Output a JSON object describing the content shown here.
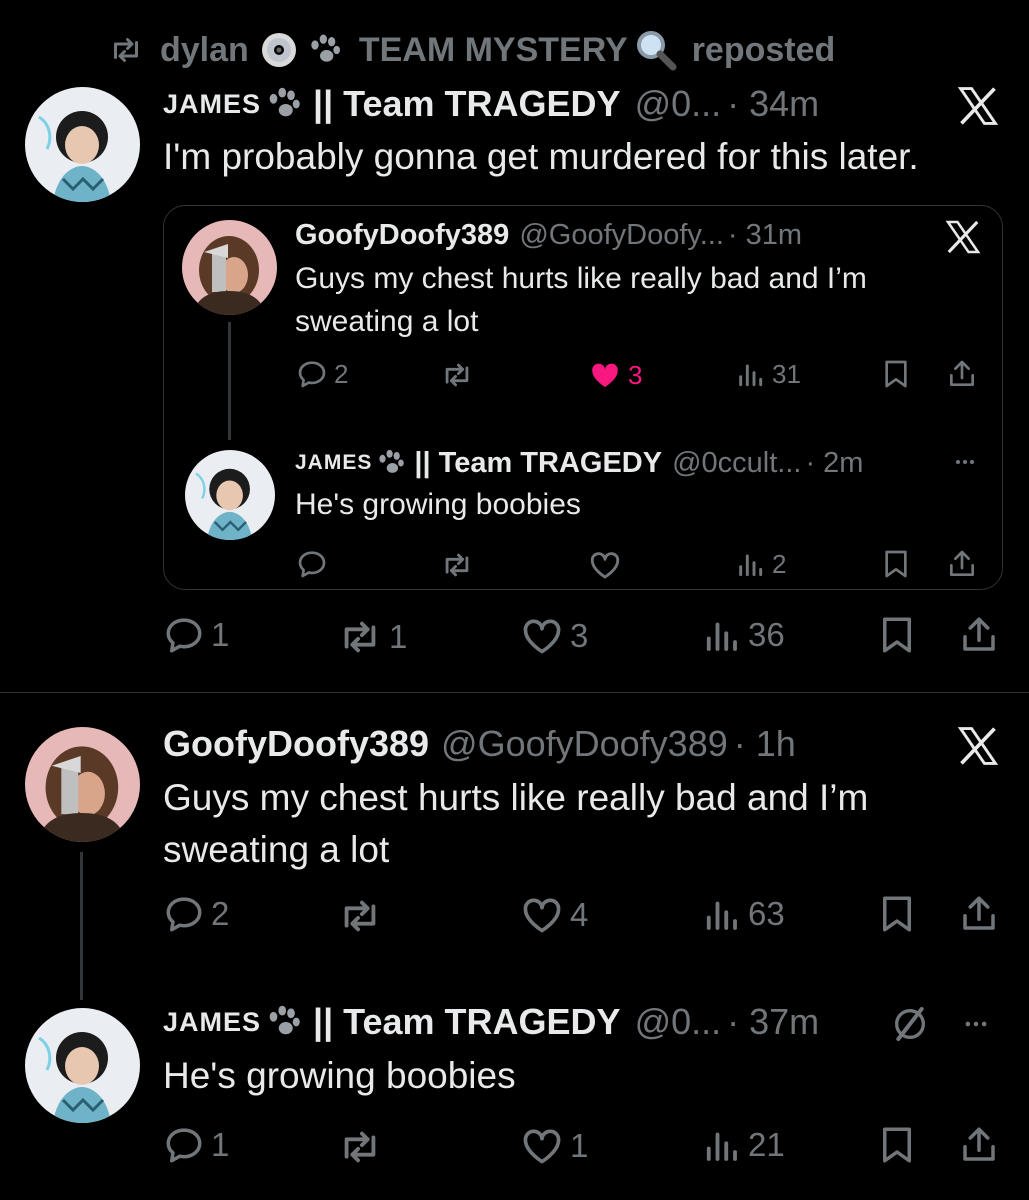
{
  "repost_bar": {
    "reposter_name": "dylan",
    "reposter_extra": "TEAM MYSTERY",
    "label": "reposted"
  },
  "tweet1": {
    "author": "JAMES",
    "team": "|| Team TRAGEDY",
    "handle": "@0...",
    "time": "· 34m",
    "text": "I'm probably gonna get murdered for this later.",
    "stats": {
      "replies": "1",
      "reposts": "1",
      "likes": "3",
      "views": "36"
    }
  },
  "quote": {
    "post1": {
      "author": "GoofyDoofy389",
      "handle": "@GoofyDoofy...",
      "time": "· 31m",
      "text_line1": "Guys my chest hurts like really bad and I’m",
      "text_line2": "sweating a lot",
      "stats": {
        "replies": "2",
        "likes": "3",
        "views": "31"
      }
    },
    "post2": {
      "author": "JAMES",
      "team": "|| Team TRAGEDY",
      "handle": "@0ccult...",
      "time": "· 2m",
      "text": "He's growing boobies",
      "stats": {
        "views": "2"
      }
    }
  },
  "tweet2": {
    "author": "GoofyDoofy389",
    "handle": "@GoofyDoofy389",
    "time": "· 1h",
    "text_line1": "Guys my chest hurts like really bad and I’m",
    "text_line2": "sweating a lot",
    "stats": {
      "replies": "2",
      "likes": "4",
      "views": "63"
    }
  },
  "tweet3": {
    "author": "JAMES",
    "team": "|| Team TRAGEDY",
    "handle": "@0...",
    "time": "· 37m",
    "text": "He's growing boobies",
    "stats": {
      "replies": "1",
      "likes": "1",
      "views": "21"
    }
  },
  "colors": {
    "background": "#000000",
    "text": "#e7e9ea",
    "muted": "#71767b",
    "like_active": "#f91880",
    "divider": "#2f3336"
  },
  "icons": [
    "repost-icon",
    "cd-icon",
    "paw-icon",
    "magnifier-icon",
    "x-logo-icon",
    "reply-icon",
    "like-icon",
    "views-icon",
    "bookmark-icon",
    "share-icon",
    "more-icon",
    "grok-icon"
  ]
}
